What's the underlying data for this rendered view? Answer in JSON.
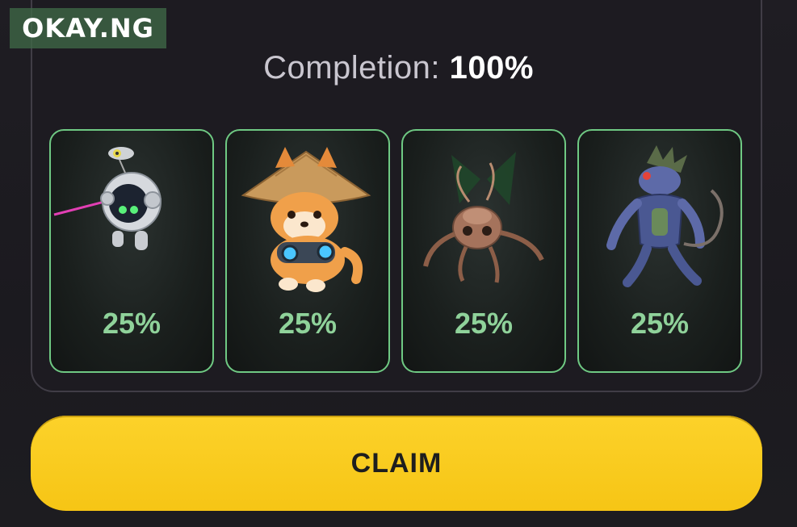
{
  "watermark": {
    "text": "OKAY.NG"
  },
  "completion": {
    "label": "Completion:",
    "value": "100%"
  },
  "cards": [
    {
      "pct": "25%",
      "icon": "robot-drone-icon"
    },
    {
      "pct": "25%",
      "icon": "shiba-dog-hat-icon"
    },
    {
      "pct": "25%",
      "icon": "insect-creature-icon"
    },
    {
      "pct": "25%",
      "icon": "cyborg-rat-icon"
    }
  ],
  "button": {
    "label": "CLAIM"
  },
  "colors": {
    "accent_green": "#6fc983",
    "claim_yellow": "#f9cb1e",
    "background": "#1c1a20"
  }
}
